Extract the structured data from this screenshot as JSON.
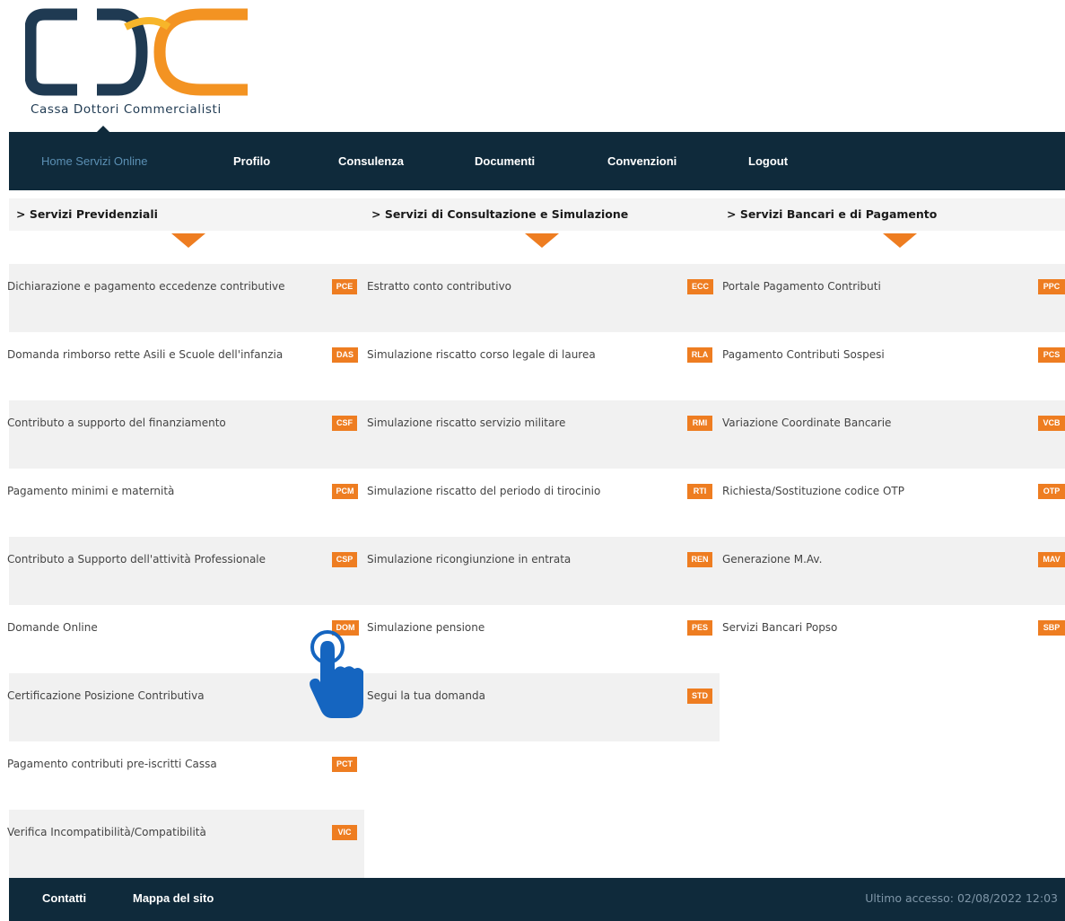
{
  "logo": {
    "text": "Cassa Dottori Commercialisti",
    "colors": {
      "navy": "#1f3a52",
      "orange": "#f39322",
      "gold": "#f7b52a"
    }
  },
  "nav": {
    "items": [
      {
        "label": "Home Servizi Online",
        "active": true
      },
      {
        "label": "Profilo"
      },
      {
        "label": "Consulenza"
      },
      {
        "label": "Documenti"
      },
      {
        "label": "Convenzioni"
      },
      {
        "label": "Logout"
      }
    ]
  },
  "sections": [
    {
      "title": "> Servizi Previdenziali",
      "items": [
        {
          "label": "Dichiarazione e pagamento eccedenze contributive",
          "code": "PCE"
        },
        {
          "label": "Domanda rimborso rette Asili e Scuole dell'infanzia",
          "code": "DAS"
        },
        {
          "label": "Contributo a supporto del finanziamento",
          "code": "CSF"
        },
        {
          "label": "Pagamento minimi e maternità",
          "code": "PCM"
        },
        {
          "label": "Contributo a Supporto dell'attività Professionale",
          "code": "CSP"
        },
        {
          "label": "Domande Online",
          "code": "DOM"
        },
        {
          "label": "Certificazione Posizione Contributiva",
          "code": ""
        },
        {
          "label": "Pagamento contributi pre-iscritti Cassa",
          "code": "PCT"
        },
        {
          "label": "Verifica Incompatibilità/Compatibilità",
          "code": "VIC"
        }
      ]
    },
    {
      "title": "> Servizi di Consultazione e Simulazione",
      "items": [
        {
          "label": "Estratto conto contributivo",
          "code": "ECC"
        },
        {
          "label": "Simulazione riscatto corso legale di laurea",
          "code": "RLA"
        },
        {
          "label": "Simulazione riscatto servizio militare",
          "code": "RMI"
        },
        {
          "label": "Simulazione riscatto del periodo di tirocinio",
          "code": "RTI"
        },
        {
          "label": "Simulazione ricongiunzione in entrata",
          "code": "REN"
        },
        {
          "label": "Simulazione pensione",
          "code": "PES"
        },
        {
          "label": "Segui la tua domanda",
          "code": "STD"
        }
      ]
    },
    {
      "title": "> Servizi Bancari e di Pagamento",
      "items": [
        {
          "label": "Portale Pagamento Contributi",
          "code": "PPC"
        },
        {
          "label": "Pagamento Contributi Sospesi",
          "code": "PCS"
        },
        {
          "label": "Variazione Coordinate Bancarie",
          "code": "VCB"
        },
        {
          "label": "Richiesta/Sostituzione codice OTP",
          "code": "OTP"
        },
        {
          "label": "Generazione M.Av.",
          "code": "MAV"
        },
        {
          "label": "Servizi Bancari Popso",
          "code": "SBP"
        }
      ]
    }
  ],
  "footer": {
    "contatti": "Contatti",
    "mappa": "Mappa del sito",
    "last_access": "Ultimo accesso: 02/08/2022 12:03"
  },
  "colors": {
    "nav_bg": "#0f2a3b",
    "accent": "#ee7d21",
    "row_alt": "#f1f1f1",
    "hand": "#1565c0"
  },
  "overlay": {
    "icon": "pointer-hand-icon"
  }
}
